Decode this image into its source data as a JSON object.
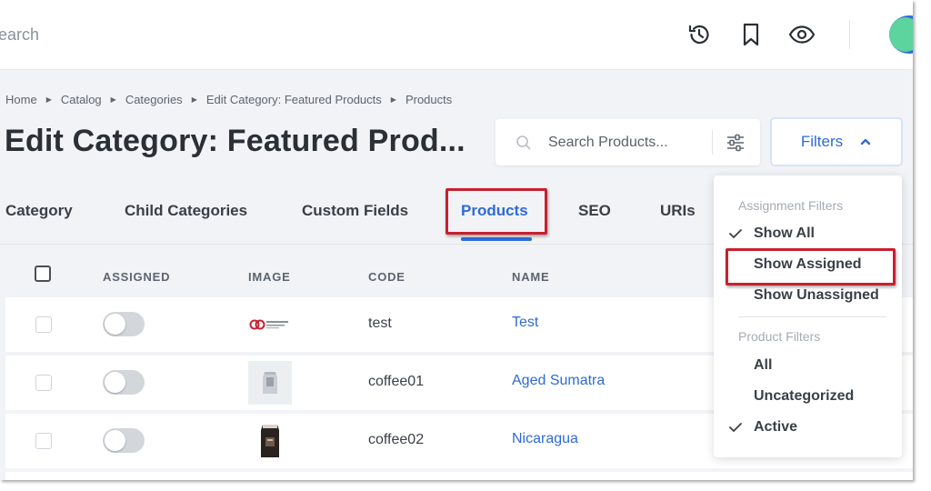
{
  "topbar": {
    "search_placeholder": "earch",
    "icons": [
      "history-icon",
      "bookmark-icon",
      "eye-icon"
    ]
  },
  "breadcrumb": [
    "Home",
    "Catalog",
    "Categories",
    "Edit Category: Featured Products",
    "Products"
  ],
  "page_title": "Edit Category: Featured Prod...",
  "product_search": {
    "placeholder": "Search Products..."
  },
  "filters_button": {
    "label": "Filters"
  },
  "tabs": [
    {
      "label": "Category"
    },
    {
      "label": "Child Categories"
    },
    {
      "label": "Custom Fields"
    },
    {
      "label": "Products",
      "active": true
    },
    {
      "label": "SEO"
    },
    {
      "label": "URIs"
    }
  ],
  "table": {
    "columns": [
      "ASSIGNED",
      "IMAGE",
      "CODE",
      "NAME"
    ],
    "rows": [
      {
        "code": "test",
        "name": "Test",
        "image": "glendale-designs-logo",
        "assigned": false
      },
      {
        "code": "coffee01",
        "name": "Aged Sumatra",
        "image": "coffee-bag-silver",
        "assigned": false
      },
      {
        "code": "coffee02",
        "name": "Nicaragua",
        "image": "coffee-bag-dark",
        "assigned": false
      }
    ]
  },
  "filters_menu": {
    "assignment_title": "Assignment Filters",
    "assignment_items": [
      {
        "label": "Show All",
        "checked": true
      },
      {
        "label": "Show Assigned",
        "checked": false
      },
      {
        "label": "Show Unassigned",
        "checked": false
      }
    ],
    "product_title": "Product Filters",
    "product_items": [
      {
        "label": "All",
        "checked": false
      },
      {
        "label": "Uncategorized",
        "checked": false
      },
      {
        "label": "Active",
        "checked": true
      }
    ]
  },
  "colors": {
    "accent": "#2f6ad9",
    "highlight": "#c8202f",
    "background": "#f1f3f6"
  }
}
